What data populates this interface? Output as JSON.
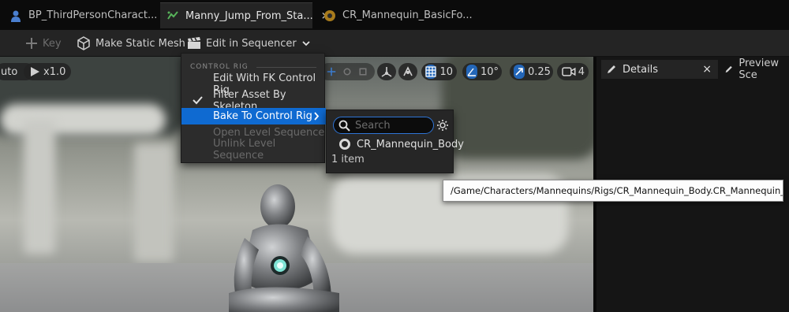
{
  "tabs": [
    {
      "label": "BP_ThirdPersonCharact...",
      "icon": "person-icon"
    },
    {
      "label": "Manny_Jump_From_Sta...",
      "icon": "animation-icon",
      "close": "×"
    },
    {
      "label": "CR_Mannequin_BasicFo...",
      "icon": "control-rig-icon"
    }
  ],
  "toolbar": {
    "key_label": "Key",
    "make_static_mesh_label": "Make Static Mesh",
    "edit_in_sequencer_label": "Edit in Sequencer"
  },
  "viewport": {
    "auto_label": "uto",
    "speed_label": "x1.0",
    "grid_snap_value": "10",
    "rotation_snap_value": "10°",
    "scale_snap_value": "0.25",
    "camera_speed_value": "4"
  },
  "right_panel": {
    "details_label": "Details",
    "details_close": "×",
    "preview_label": "Preview Sce"
  },
  "menu": {
    "section_header": "CONTROL RIG",
    "items": [
      {
        "label": "Edit With FK Control Rig",
        "state": "normal"
      },
      {
        "label": "Filter Asset By Skeleton",
        "state": "checked"
      },
      {
        "label": "Bake To Control Rig",
        "state": "highlighted"
      },
      {
        "label": "Open Level Sequence",
        "state": "disabled"
      },
      {
        "label": "Unlink Level Sequence",
        "state": "disabled"
      }
    ]
  },
  "submenu": {
    "search_placeholder": "Search",
    "items": [
      {
        "label": "CR_Mannequin_Body"
      }
    ],
    "count_label": "1 item"
  },
  "tooltip": {
    "text": "/Game/Characters/Mannequins/Rigs/CR_Mannequin_Body.CR_Mannequin_Body_C"
  },
  "colors": {
    "accent": "#0f6ad1",
    "panel_bg": "#242424",
    "menu_bg": "#2c2c2c"
  }
}
